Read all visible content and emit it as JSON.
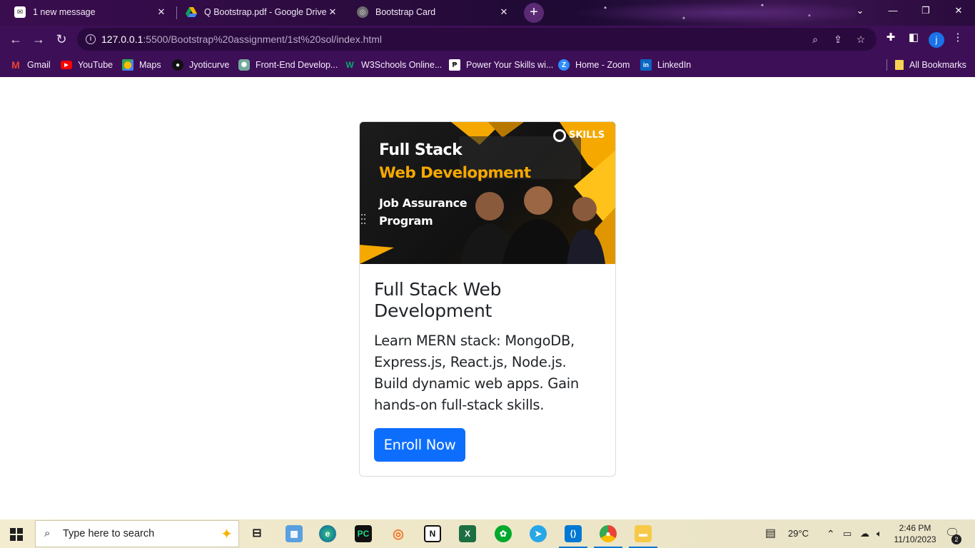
{
  "browser": {
    "tabs": [
      {
        "title": "1 new message",
        "icon": "mail-icon"
      },
      {
        "title": "Q Bootstrap.pdf - Google Drive",
        "icon": "google-drive-icon"
      },
      {
        "title": "Bootstrap Card",
        "icon": "globe-icon",
        "active": true
      }
    ],
    "new_tab": "+",
    "url_host": "127.0.0.1",
    "url_path": ":5500/Bootstrap%20assignment/1st%20sol/index.html",
    "profile_initial": "j",
    "bookmarks": [
      {
        "label": "Gmail",
        "icon": "gmail-icon"
      },
      {
        "label": "YouTube",
        "icon": "youtube-icon"
      },
      {
        "label": "Maps",
        "icon": "maps-icon"
      },
      {
        "label": "Jyoticurve",
        "icon": "github-icon"
      },
      {
        "label": "Front-End Develop...",
        "icon": "chatgpt-icon"
      },
      {
        "label": "W3Schools Online...",
        "icon": "w3schools-icon"
      },
      {
        "label": "Power Your Skills wi...",
        "icon": "pw-icon"
      },
      {
        "label": "Home - Zoom",
        "icon": "zoom-icon"
      },
      {
        "label": "LinkedIn",
        "icon": "linkedin-icon"
      }
    ],
    "all_bookmarks": "All Bookmarks"
  },
  "card": {
    "image": {
      "brand": "SKILLS",
      "line1": "Full Stack",
      "line2": "Web Development",
      "line3": "Job Assurance",
      "line4": "Program"
    },
    "title": "Full Stack Web Development",
    "text": "Learn MERN stack: MongoDB, Express.js, React.js, Node.js. Build dynamic web apps. Gain hands-on full-stack skills.",
    "button": "Enroll Now",
    "colors": {
      "button": "#0d6efd",
      "accent": "#f5a800"
    }
  },
  "taskbar": {
    "search_placeholder": "Type here to search",
    "weather": "29°C",
    "time": "2:46 PM",
    "date": "11/10/2023",
    "notifications": "2"
  }
}
